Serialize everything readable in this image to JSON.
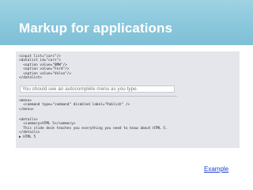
{
  "slide": {
    "title": "Markup for applications",
    "link_label": "Example"
  },
  "code_panel": {
    "datalist_lines": [
      "<input list=\"cars\"/>",
      "<datalist id=\"cars\">",
      "  <option value=\"BMW\"/>",
      "  <option value=\"Ford\"/>",
      "  <option value=\"Volvo\"/>",
      "</datalist>"
    ],
    "autocomplete_placeholder": "You should see an autocomplete menu as you type.",
    "menu_lines": [
      "<menu>",
      "  <command type=\"command\" disabled label=\"Publish\" />",
      "</menu>"
    ],
    "details_lines": [
      "<details>",
      "  <summary>HTML 5</summary>",
      "  This slide deck teaches you everything you need to know about HTML 5.",
      "</details>",
      "▶ HTML 5"
    ]
  },
  "colors": {
    "header_band": "#8ac7dc",
    "panel_background": "#e4e6ec",
    "link": "#1a3fd6"
  }
}
